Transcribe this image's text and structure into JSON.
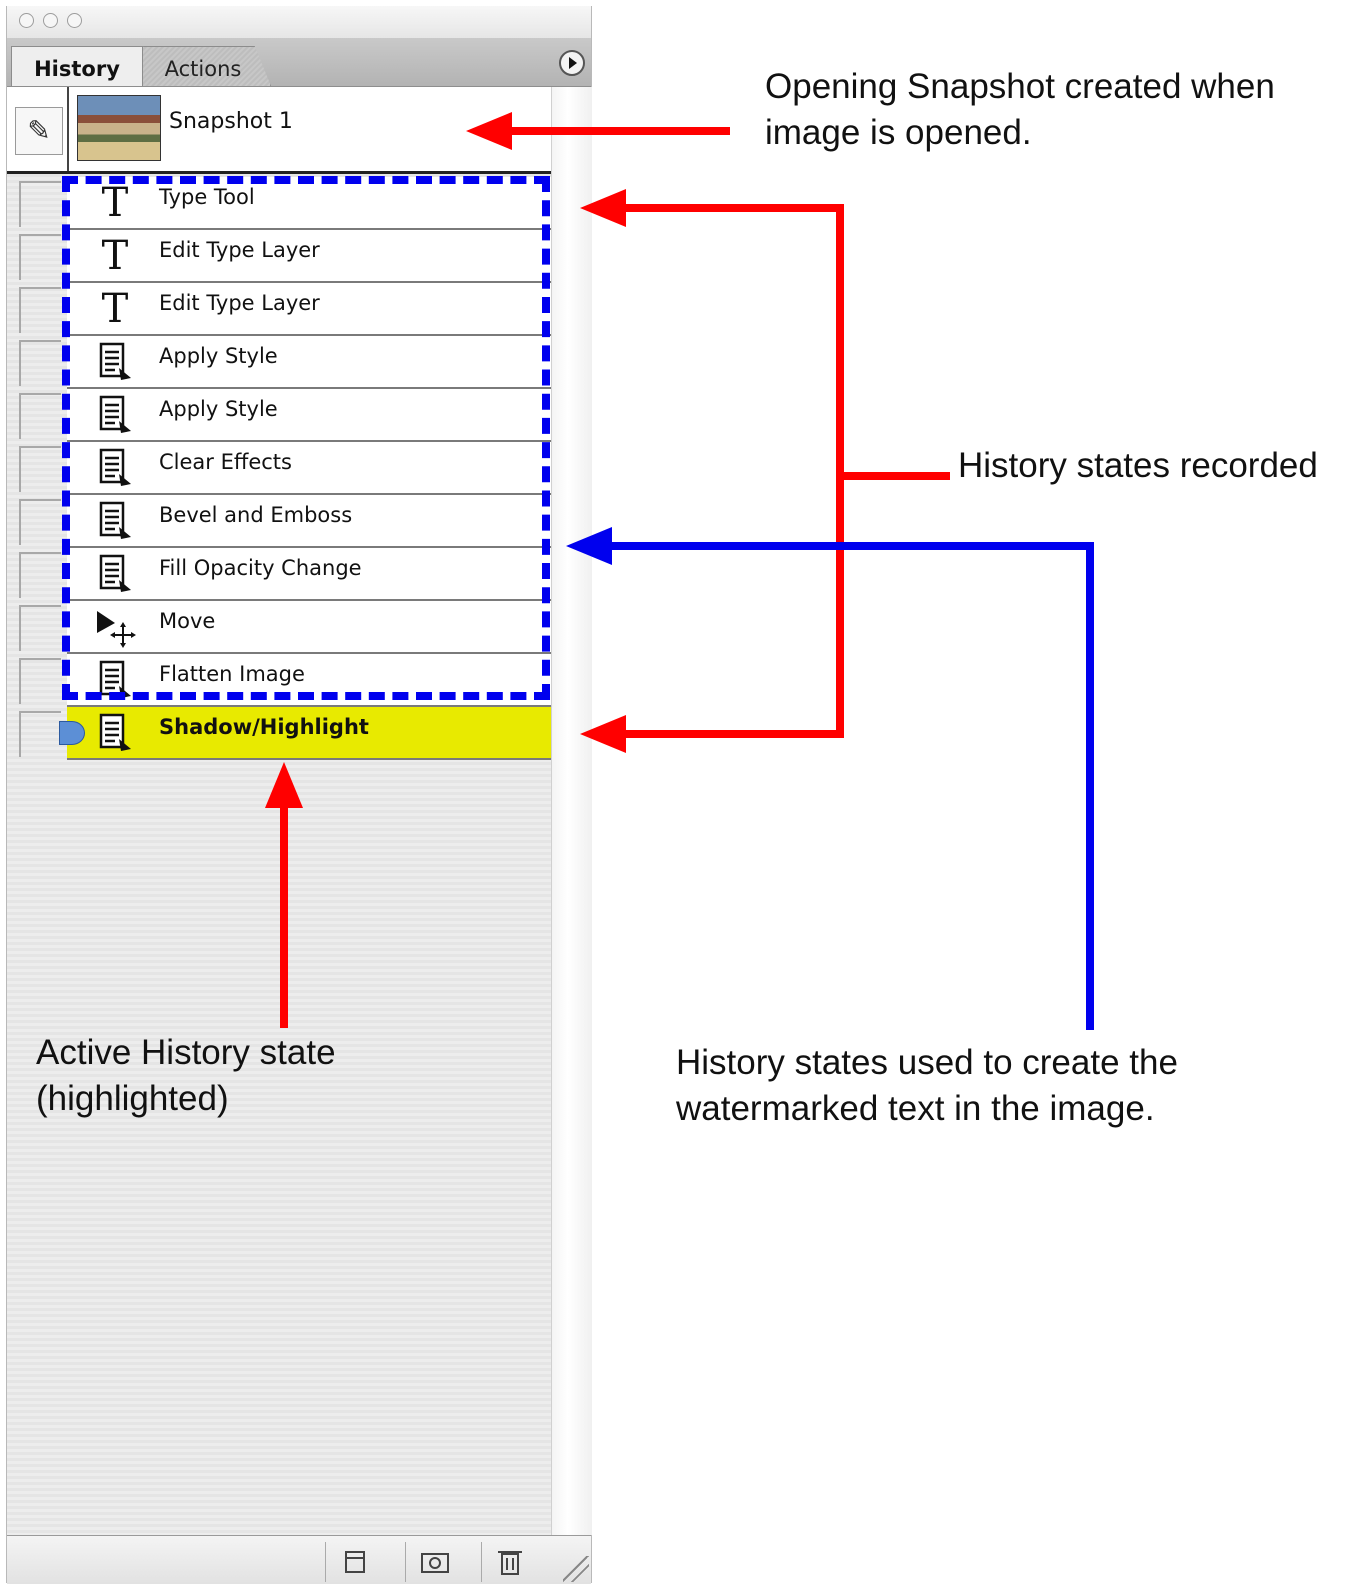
{
  "panel": {
    "tabs": [
      {
        "label": "History",
        "active": true
      },
      {
        "label": "Actions",
        "active": false
      }
    ],
    "snapshot": {
      "label": "Snapshot 1"
    },
    "states": [
      {
        "label": "Type Tool",
        "icon": "type-icon"
      },
      {
        "label": "Edit Type Layer",
        "icon": "type-icon"
      },
      {
        "label": "Edit Type Layer",
        "icon": "type-icon"
      },
      {
        "label": "Apply Style",
        "icon": "document-icon"
      },
      {
        "label": "Apply Style",
        "icon": "document-icon"
      },
      {
        "label": "Clear Effects",
        "icon": "document-icon"
      },
      {
        "label": "Bevel and Emboss",
        "icon": "document-icon"
      },
      {
        "label": "Fill Opacity Change",
        "icon": "document-icon"
      },
      {
        "label": "Move",
        "icon": "move-icon"
      },
      {
        "label": "Flatten Image",
        "icon": "document-icon"
      },
      {
        "label": "Shadow/Highlight",
        "icon": "document-icon",
        "active": true
      }
    ],
    "active_color": "#e8ea00",
    "footer_buttons": [
      "new-document-icon",
      "camera-icon",
      "trash-icon"
    ]
  },
  "annotations": {
    "opening_snapshot": "Opening Snapshot created when\nimage is opened.",
    "states_recorded": "History states recorded",
    "states_used": "History states used to create the\nwatermarked text in the image.",
    "active_state": "Active History state\n(highlighted)"
  },
  "colors": {
    "red_arrow": "#ff0000",
    "blue_arrow": "#0000ee",
    "dash_box": "#0000ee"
  }
}
